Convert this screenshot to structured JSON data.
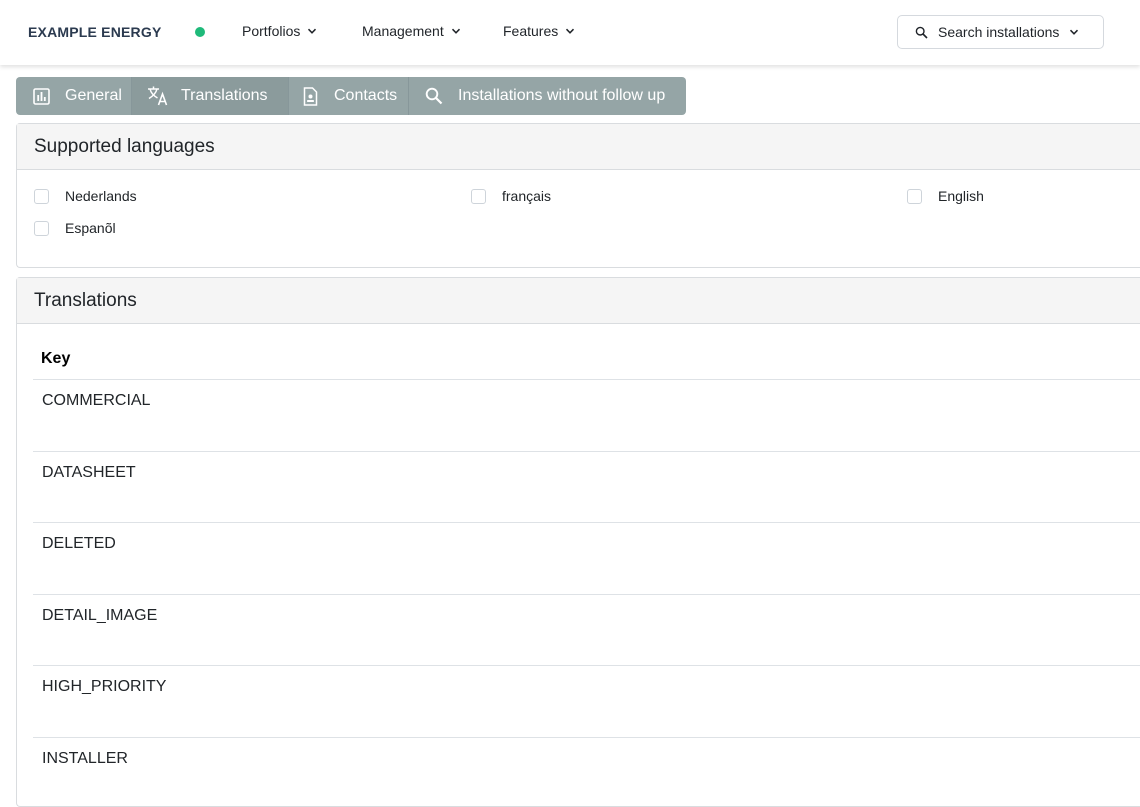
{
  "header": {
    "brand": "EXAMPLE ENERGY",
    "status_color": "#1fba7a",
    "nav": [
      {
        "label": "Portfolios",
        "icon": "chevron-down-icon"
      },
      {
        "label": "Management",
        "icon": "chevron-down-icon"
      },
      {
        "label": "Features",
        "icon": "chevron-down-icon"
      }
    ],
    "search": {
      "label": "Search installations",
      "icon": "search-icon"
    }
  },
  "tabs": [
    {
      "label": "General",
      "icon": "bar-chart-icon",
      "active": false
    },
    {
      "label": "Translations",
      "icon": "translate-icon",
      "active": true
    },
    {
      "label": "Contacts",
      "icon": "contact-card-icon",
      "active": false
    },
    {
      "label": "Installations without follow up",
      "icon": "search-icon",
      "active": false
    }
  ],
  "supported_languages": {
    "title": "Supported languages",
    "languages": [
      "Nederlands",
      "français",
      "English",
      "Espanõl"
    ]
  },
  "translations": {
    "title": "Translations",
    "column_key": "Key",
    "keys": [
      "COMMERCIAL",
      "DATASHEET",
      "DELETED",
      "DETAIL_IMAGE",
      "HIGH_PRIORITY",
      "INSTALLER"
    ]
  },
  "colors": {
    "tab_bar": "#95a5a6",
    "tab_active": "#8b9b9c",
    "brand_text": "#2b3a4f"
  }
}
